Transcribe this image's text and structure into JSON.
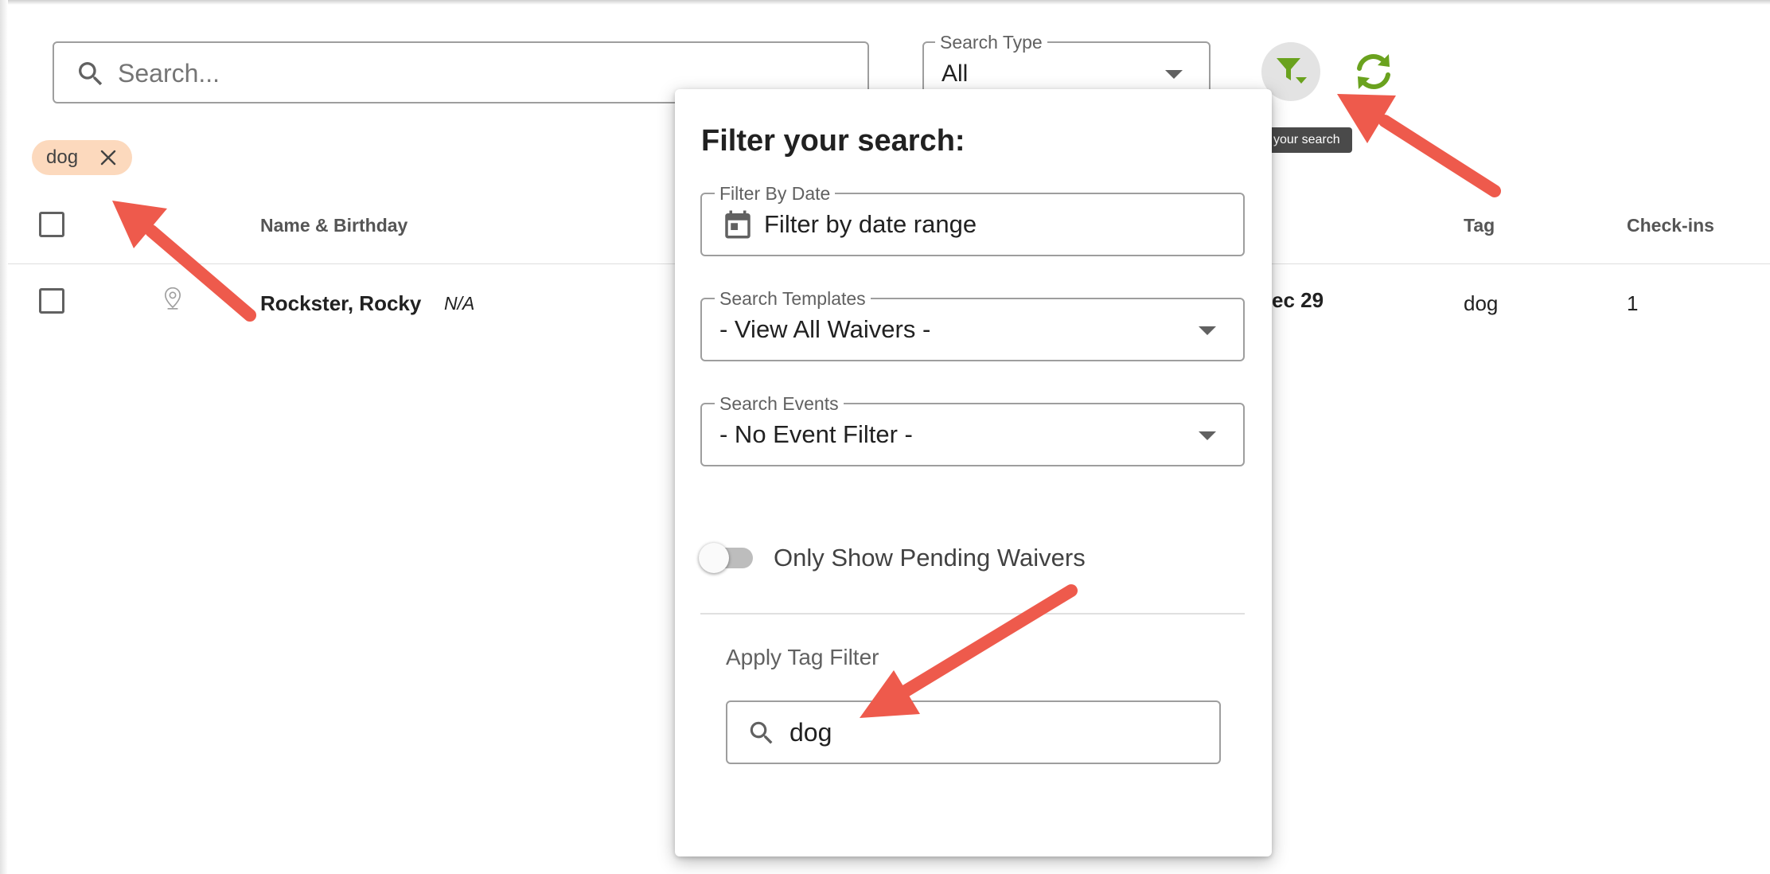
{
  "search": {
    "placeholder": "Search...",
    "icon": "search-icon"
  },
  "search_type": {
    "label": "Search Type",
    "value": "All"
  },
  "toolbar": {
    "filter_icon": "filter-icon",
    "refresh_icon": "refresh-icon",
    "filter_tooltip": "your search",
    "accent_color": "#6aa21e"
  },
  "chips": [
    {
      "label": "dog"
    }
  ],
  "table": {
    "columns": {
      "name": "Name & Birthday",
      "tag": "Tag",
      "checkins": "Check-ins"
    },
    "rows": [
      {
        "name": "Rockster, Rocky",
        "birthday": "N/A",
        "date_partial": "ec 29",
        "tag": "dog",
        "checkins": "1"
      }
    ]
  },
  "filter_panel": {
    "title": "Filter your search:",
    "date": {
      "label": "Filter By Date",
      "value": "Filter by date range"
    },
    "templates": {
      "label": "Search Templates",
      "value": "- View All Waivers -"
    },
    "events": {
      "label": "Search Events",
      "value": "- No Event Filter -"
    },
    "pending_toggle": {
      "label": "Only Show Pending Waivers",
      "on": false
    },
    "tag_filter": {
      "label": "Apply Tag Filter",
      "value": "dog"
    }
  },
  "annotation_color": "#ee5a4c"
}
